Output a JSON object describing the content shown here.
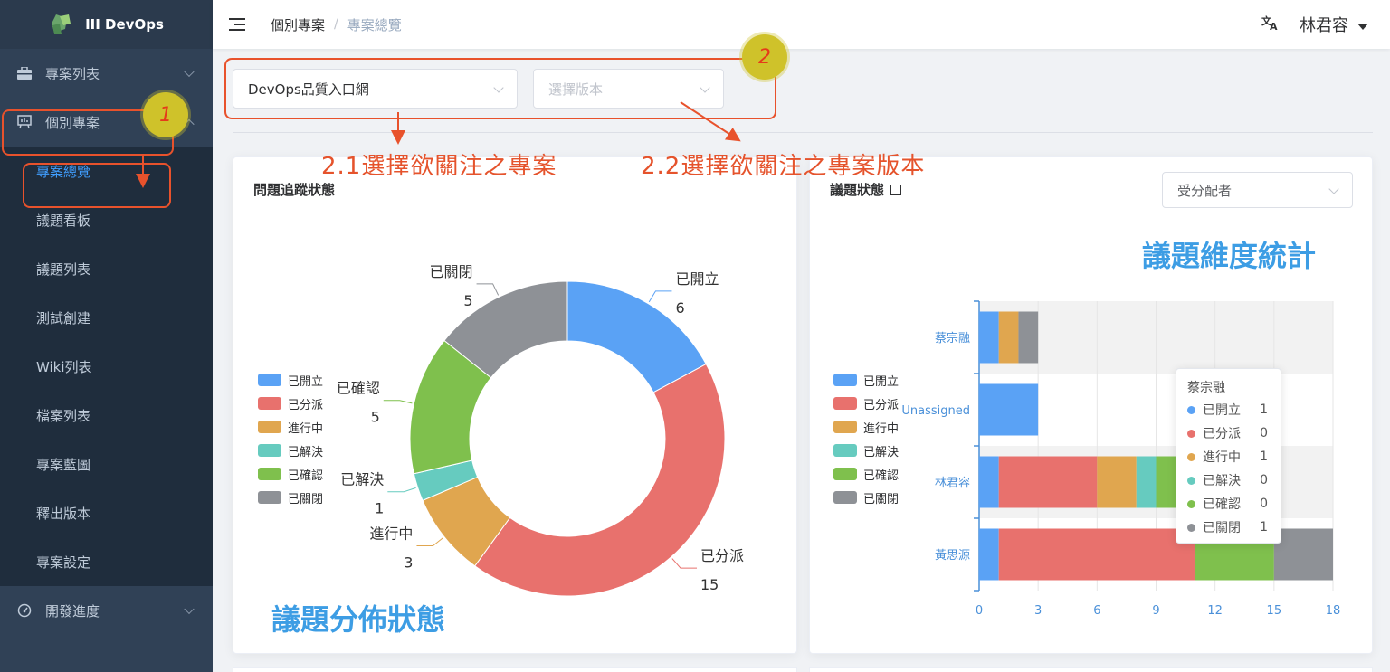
{
  "app": {
    "title": "III DevOps"
  },
  "sidebar": {
    "menu_project_list": "專案列表",
    "menu_individual": "個別專案",
    "sub_items": [
      "專案總覽",
      "議題看板",
      "議題列表",
      "測試創建",
      "Wiki列表",
      "檔案列表",
      "專案藍圖",
      "釋出版本",
      "專案設定"
    ],
    "menu_dev_progress": "開發進度"
  },
  "header": {
    "breadcrumb_parent": "個別專案",
    "breadcrumb_sep": "/",
    "breadcrumb_current": "專案總覽",
    "user_name": "林君容"
  },
  "filters": {
    "project_value": "DevOps品質入口網",
    "version_placeholder": "選擇版本"
  },
  "issue_tracking": {
    "title": "問題追蹤狀態",
    "legend": [
      "已開立",
      "已分派",
      "進行中",
      "已解決",
      "已確認",
      "已關閉"
    ]
  },
  "issue_status": {
    "title": "議題狀態",
    "assignee_placeholder": "受分配者",
    "legend": [
      "已開立",
      "已分派",
      "進行中",
      "已解決",
      "已確認",
      "已關閉"
    ]
  },
  "colors": {
    "opened": "#5aa2f5",
    "assigned": "#e8716d",
    "in_progress": "#e0a64f",
    "solved": "#66cbbf",
    "verified": "#7fc04d",
    "closed": "#8e9196"
  },
  "chart_data": [
    {
      "type": "pie",
      "donut": true,
      "categories": [
        "已開立",
        "已分派",
        "進行中",
        "已解決",
        "已確認",
        "已關閉"
      ],
      "values": [
        6,
        15,
        3,
        1,
        5,
        5
      ],
      "legend": "left"
    },
    {
      "type": "bar",
      "orientation": "horizontal",
      "stacked": true,
      "categories": [
        "蔡宗融",
        "Unassigned",
        "林君容",
        "黃思源"
      ],
      "series": [
        {
          "name": "已開立",
          "values": [
            1,
            3,
            1,
            1
          ]
        },
        {
          "name": "已分派",
          "values": [
            0,
            0,
            5,
            10
          ]
        },
        {
          "name": "進行中",
          "values": [
            1,
            0,
            2,
            0
          ]
        },
        {
          "name": "已解決",
          "values": [
            0,
            0,
            1,
            0
          ]
        },
        {
          "name": "已確認",
          "values": [
            0,
            0,
            1,
            4
          ]
        },
        {
          "name": "已關閉",
          "values": [
            1,
            0,
            0,
            3
          ]
        }
      ],
      "x_ticks": [
        "0",
        "3",
        "6",
        "9",
        "12",
        "15",
        "18"
      ],
      "xlim": [
        0,
        18
      ],
      "legend": "left"
    }
  ],
  "tooltip": {
    "title": "蔡宗融",
    "rows": [
      {
        "label": "已開立",
        "value": "1"
      },
      {
        "label": "已分派",
        "value": "0"
      },
      {
        "label": "進行中",
        "value": "1"
      },
      {
        "label": "已解決",
        "value": "0"
      },
      {
        "label": "已確認",
        "value": "0"
      },
      {
        "label": "已關閉",
        "value": "1"
      }
    ]
  },
  "annotations": {
    "badge1": "1",
    "badge2": "2",
    "text_select_project": "2.1選擇欲關注之專案",
    "text_select_version": "2.2選擇欲關注之專案版本",
    "text_issue_dimension": "議題維度統計",
    "text_issue_distribution": "議題分佈狀態"
  }
}
